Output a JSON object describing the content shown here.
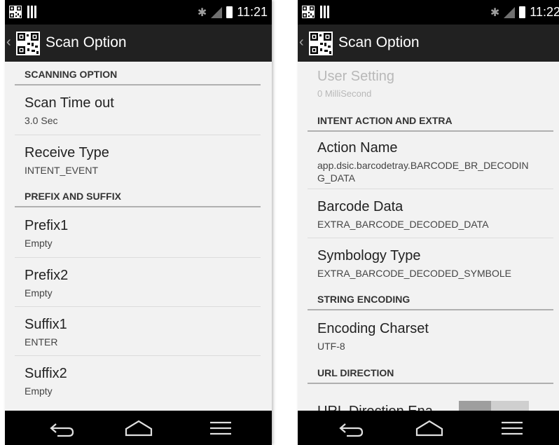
{
  "left": {
    "status_time": "11:21",
    "title": "Scan Option",
    "categories": {
      "scanning": "SCANNING OPTION",
      "prefix_suffix": "PREFIX AND SUFFIX"
    },
    "prefs": {
      "scan_timeout": {
        "title": "Scan Time out",
        "summary": "3.0 Sec"
      },
      "receive_type": {
        "title": "Receive Type",
        "summary": "INTENT_EVENT"
      },
      "prefix1": {
        "title": "Prefix1",
        "summary": "Empty"
      },
      "prefix2": {
        "title": "Prefix2",
        "summary": "Empty"
      },
      "suffix1": {
        "title": "Suffix1",
        "summary": "ENTER"
      },
      "suffix2": {
        "title": "Suffix2",
        "summary": "Empty"
      }
    }
  },
  "right": {
    "status_time": "11:22",
    "title": "Scan Option",
    "categories": {
      "intent": "INTENT ACTION AND EXTRA",
      "string_encoding": "STRING ENCODING",
      "url_direction": "URL DIRECTION"
    },
    "prefs": {
      "user_setting": {
        "title": "User Setting",
        "summary": "0 MilliSecond"
      },
      "action_name": {
        "title": "Action Name",
        "summary_line1": "app.dsic.barcodetray.BARCODE_BR_DECODIN",
        "summary_line2": "G_DATA"
      },
      "barcode_data": {
        "title": "Barcode Data",
        "summary": "EXTRA_BARCODE_DECODED_DATA"
      },
      "symbology_type": {
        "title": "Symbology Type",
        "summary": "EXTRA_BARCODE_DECODED_SYMBOLE"
      },
      "encoding_charset": {
        "title": "Encoding Charset",
        "summary": "UTF-8"
      },
      "url_direction_enable": {
        "title": "URL Direction Ena"
      }
    }
  },
  "icons": {
    "status_qr": "qr-code-icon",
    "status_bars": "barcode-icon",
    "bluetooth": "bluetooth-icon",
    "signal": "signal-icon",
    "battery": "battery-icon",
    "app": "qr-code-icon",
    "nav_back": "back-icon",
    "nav_home": "home-icon",
    "nav_recent": "menu-icon"
  },
  "colors": {
    "status_bar": "#000000",
    "action_bar": "#212121",
    "background": "#f2f2f2",
    "divider": "#b0b0b0"
  }
}
